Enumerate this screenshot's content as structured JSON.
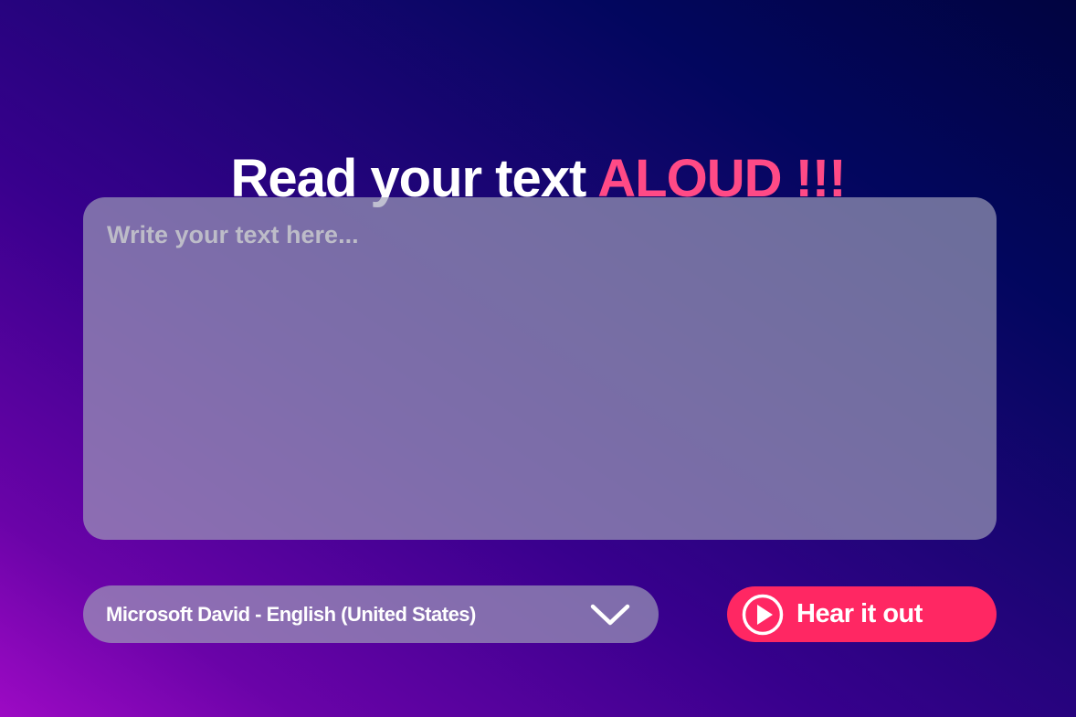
{
  "header": {
    "title_main": "Read your text ",
    "title_accent": "ALOUD !!!"
  },
  "editor": {
    "placeholder": "Write your text here...",
    "value": ""
  },
  "voice_select": {
    "selected": "Microsoft David - English (United States)",
    "icon": "chevron-down-icon"
  },
  "action": {
    "label": "Hear it out",
    "icon": "play-circle-icon"
  },
  "colors": {
    "accent": "#ff4a86",
    "button": "#ff2763",
    "background_start": "#9d0ac4",
    "background_end": "#010440"
  }
}
